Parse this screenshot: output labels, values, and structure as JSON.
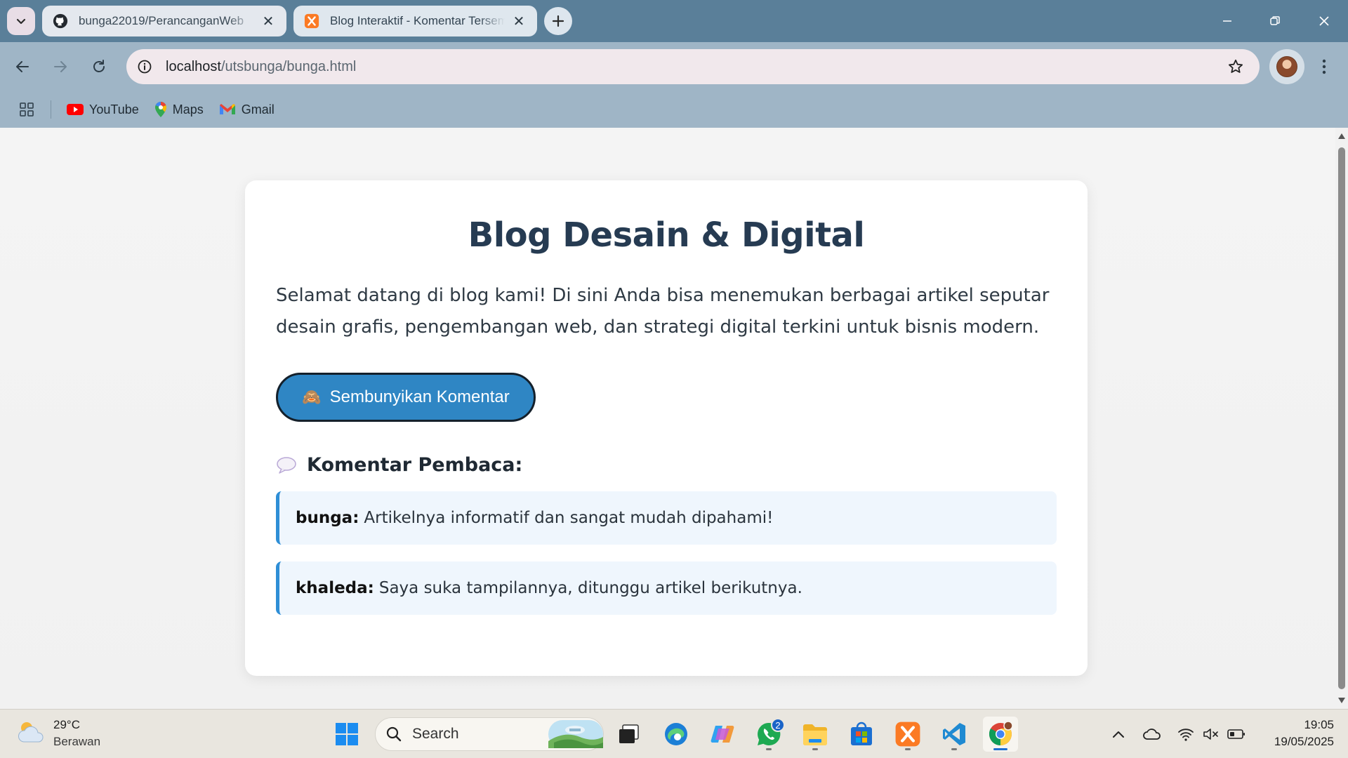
{
  "browser": {
    "tabs": [
      {
        "title": "bunga22019/PerancanganWeb",
        "favicon": "github-icon",
        "active": false
      },
      {
        "title": "Blog Interaktif - Komentar Tersembunyi",
        "favicon": "xampp-icon",
        "active": true
      }
    ],
    "address": {
      "host": "localhost",
      "path": "/utsbunga/bunga.html"
    },
    "bookmarks": [
      {
        "label": "YouTube",
        "icon": "youtube-icon"
      },
      {
        "label": "Maps",
        "icon": "maps-icon"
      },
      {
        "label": "Gmail",
        "icon": "gmail-icon"
      }
    ]
  },
  "page": {
    "title": "Blog Desain & Digital",
    "intro": "Selamat datang di blog kami! Di sini Anda bisa menemukan berbagai artikel seputar desain grafis, pengembangan web, dan strategi digital terkini untuk bisnis modern.",
    "toggle_button": {
      "emoji": "🙈",
      "label": "Sembunyikan Komentar"
    },
    "comments_heading": "Komentar Pembaca:",
    "comments": [
      {
        "author": "bunga:",
        "text": "Artikelnya informatif dan sangat mudah dipahami!"
      },
      {
        "author": "khaleda:",
        "text": "Saya suka tampilannya, ditunggu artikel berikutnya."
      }
    ],
    "colors": {
      "title": "#263b52",
      "button": "#2f86c4",
      "comment_border": "#2e8ed6",
      "comment_bg": "#eff6fd"
    }
  },
  "taskbar": {
    "weather": {
      "temp": "29°C",
      "condition": "Berawan"
    },
    "search_label": "Search",
    "whatsapp_badge": "2",
    "time": "19:05",
    "date": "19/05/2025"
  }
}
